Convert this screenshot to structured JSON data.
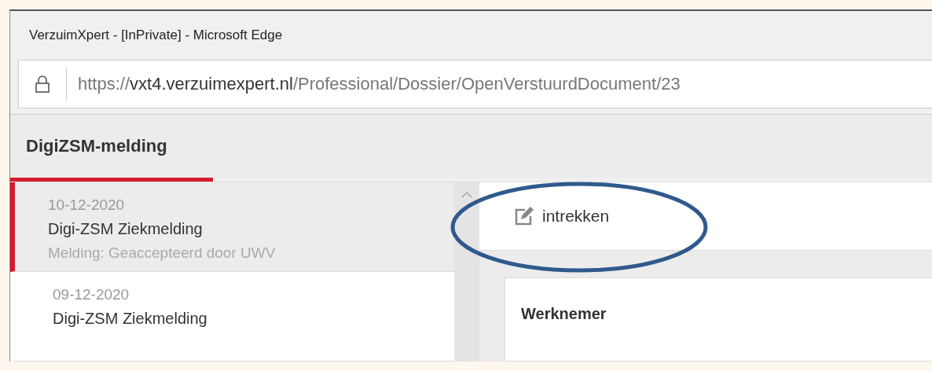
{
  "window": {
    "title": "VerzuimXpert - [InPrivate] - Microsoft Edge"
  },
  "address_bar": {
    "scheme": "https://",
    "host": "vxt4.verzuimexpert.nl",
    "path": "/Professional/Dossier/OpenVerstuurdDocument/23"
  },
  "page": {
    "heading": "DigiZSM-melding"
  },
  "list": [
    {
      "date": "10-12-2020",
      "title": "Digi-ZSM Ziekmelding",
      "status": "Melding: Geaccepteerd door UWV",
      "selected": true
    },
    {
      "date": "09-12-2020",
      "title": "Digi-ZSM Ziekmelding",
      "selected": false
    }
  ],
  "toolbar": {
    "action": "intrekken"
  },
  "card": {
    "heading": "Werknemer"
  }
}
